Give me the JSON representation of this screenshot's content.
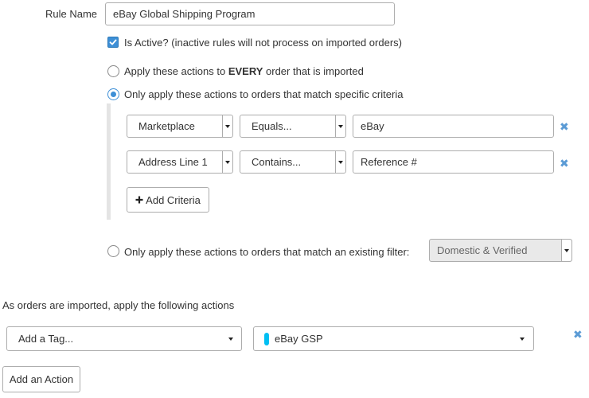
{
  "rule": {
    "name_label": "Rule Name",
    "name_value": "eBay Global Shipping Program",
    "active_label": "Is Active? (inactive rules will not process on imported orders)"
  },
  "scope": {
    "every_prefix": "Apply these actions to ",
    "every_bold": "EVERY",
    "every_suffix": " order that is imported",
    "criteria_label": "Only apply these actions to orders that match specific criteria",
    "filter_label": "Only apply these actions to orders that match an existing filter:",
    "filter_value": "Domestic & Verified"
  },
  "criteria": [
    {
      "field": "Marketplace",
      "operator": "Equals...",
      "value": "eBay"
    },
    {
      "field": "Address Line 1",
      "operator": "Contains...",
      "value": "Reference #"
    }
  ],
  "add_criteria_label": "Add Criteria",
  "actions": {
    "heading": "As orders are imported, apply the following actions",
    "action_type": "Add a Tag...",
    "tag_name": "eBay GSP",
    "tag_color": "#00bff3",
    "add_action_label": "Add an Action"
  },
  "colors": {
    "accent": "#3d8fd6",
    "remove_icon": "#5b9bd5"
  }
}
